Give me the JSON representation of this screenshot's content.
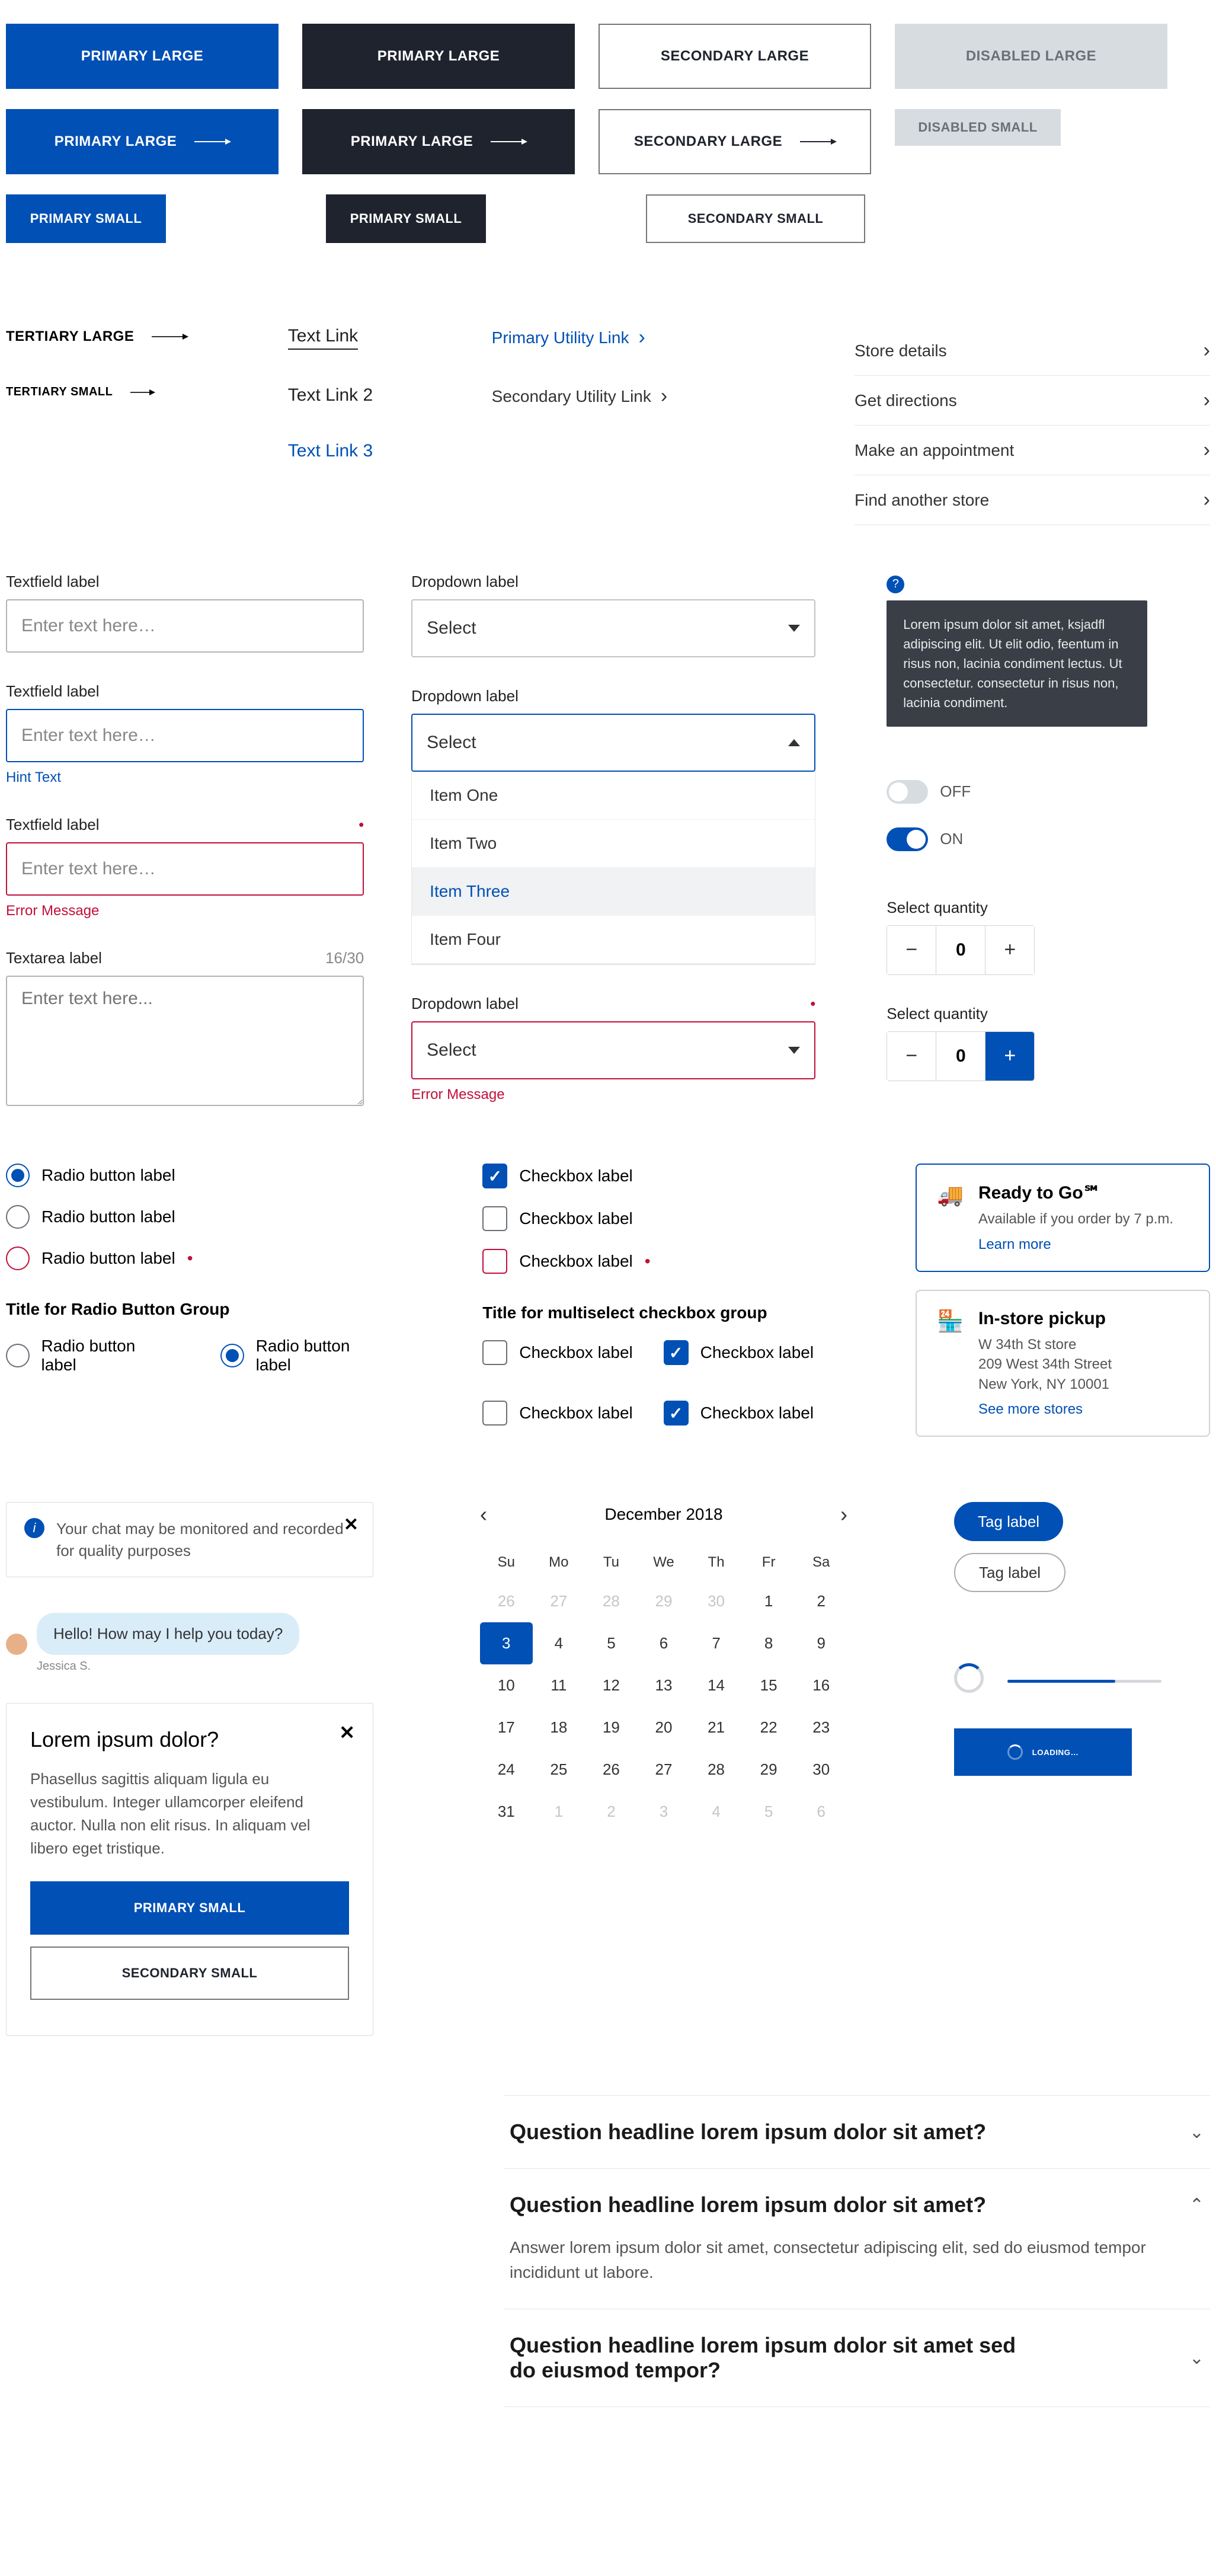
{
  "buttons": {
    "primary_large": "PRIMARY LARGE",
    "secondary_large": "SECONDARY LARGE",
    "disabled_large": "DISABLED LARGE",
    "disabled_small": "DISABLED SMALL",
    "primary_small": "PRIMARY SMALL",
    "secondary_small": "SECONDARY SMALL"
  },
  "tertiary": {
    "large": "TERTIARY LARGE",
    "small": "TERTIARY SMALL"
  },
  "links": {
    "text1": "Text Link",
    "text2": "Text Link 2",
    "text3": "Text Link 3",
    "primary_util": "Primary Utility Link",
    "secondary_util": "Secondary Utility Link"
  },
  "nav": [
    "Store details",
    "Get directions",
    "Make an appointment",
    "Find another store"
  ],
  "textfield": {
    "label": "Textfield label",
    "placeholder": "Enter text here…",
    "hint": "Hint Text",
    "error": "Error Message"
  },
  "textarea": {
    "label": "Textarea label",
    "counter": "16/30",
    "placeholder": "Enter text here..."
  },
  "dropdown": {
    "label": "Dropdown label",
    "select": "Select",
    "items": [
      "Item One",
      "Item Two",
      "Item Three",
      "Item Four"
    ],
    "error": "Error Message"
  },
  "tooltip": "Lorem ipsum dolor sit amet, ksjadfl adipiscing elit. Ut elit odio, feentum in risus non, lacinia condiment lectus. Ut consectetur. consectetur in risus non, lacinia condiment.",
  "toggle": {
    "off": "OFF",
    "on": "ON"
  },
  "qty": {
    "label": "Select quantity",
    "value": "0"
  },
  "radio": {
    "label": "Radio button label",
    "group_title": "Title for Radio Button Group"
  },
  "cb": {
    "label": "Checkbox label",
    "group_title": "Title for multiselect checkbox group"
  },
  "cards": {
    "ready": {
      "title": "Ready to Go℠",
      "sub": "Available if you order by 7 p.m.",
      "link": "Learn more"
    },
    "pickup": {
      "title": "In-store pickup",
      "l1": "W 34th St store",
      "l2": "209 West 34th Street",
      "l3": "New York, NY 10001",
      "link": "See more stores"
    }
  },
  "banner": "Your chat may be monitored and recorded for quality purposes",
  "chat": {
    "msg": "Hello! How may I help you today?",
    "name": "Jessica S."
  },
  "modal": {
    "title": "Lorem ipsum dolor?",
    "body": "Phasellus sagittis aliquam ligula eu vestibulum. Integer ullamcorper eleifend auctor. Nulla non elit risus. In aliquam vel libero eget tristique."
  },
  "cal": {
    "month": "December 2018",
    "days": [
      "Su",
      "Mo",
      "Tu",
      "We",
      "Th",
      "Fr",
      "Sa"
    ],
    "grid": [
      [
        "26",
        "27",
        "28",
        "29",
        "30",
        "1",
        "2"
      ],
      [
        "3",
        "4",
        "5",
        "6",
        "7",
        "8",
        "9"
      ],
      [
        "10",
        "11",
        "12",
        "13",
        "14",
        "15",
        "16"
      ],
      [
        "17",
        "18",
        "19",
        "20",
        "21",
        "22",
        "23"
      ],
      [
        "24",
        "25",
        "26",
        "27",
        "28",
        "29",
        "30"
      ],
      [
        "31",
        "1",
        "2",
        "3",
        "4",
        "5",
        "6"
      ]
    ]
  },
  "tags": {
    "label": "Tag label"
  },
  "loading": "LOADING…",
  "faq": {
    "q1": "Question headline lorem ipsum dolor sit amet?",
    "q2": "Question headline lorem ipsum dolor sit amet?",
    "a2": "Answer lorem ipsum dolor sit amet, consectetur adipiscing elit, sed do eiusmod tempor incididunt ut labore.",
    "q3": "Question headline lorem ipsum dolor sit amet sed do eiusmod tempor?"
  }
}
